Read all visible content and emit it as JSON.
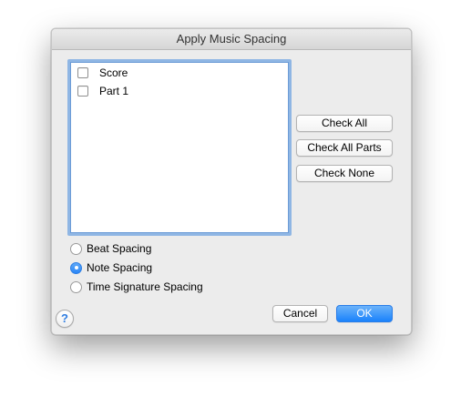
{
  "window": {
    "title": "Apply Music Spacing"
  },
  "list": {
    "items": [
      {
        "label": "Score",
        "checked": false
      },
      {
        "label": "Part 1",
        "checked": false
      }
    ]
  },
  "side_buttons": {
    "check_all": "Check All",
    "check_all_parts": "Check All Parts",
    "check_none": "Check None"
  },
  "spacing_options": [
    {
      "label": "Beat Spacing",
      "selected": false
    },
    {
      "label": "Note Spacing",
      "selected": true
    },
    {
      "label": "Time Signature Spacing",
      "selected": false
    }
  ],
  "footer": {
    "help_label": "?",
    "cancel_label": "Cancel",
    "ok_label": "OK"
  },
  "colors": {
    "accent": "#1a82fb",
    "focus_ring": "#8fb6e4",
    "window_bg": "#ececec"
  }
}
